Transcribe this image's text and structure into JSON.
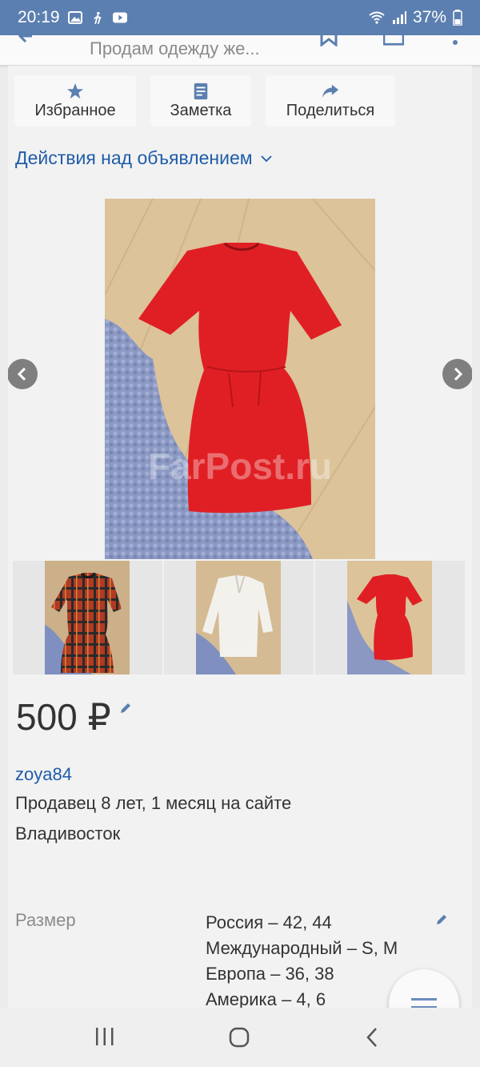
{
  "status_bar": {
    "time": "20:19",
    "battery": "37%"
  },
  "app_bar": {
    "title": "Продам одежду же..."
  },
  "actions": {
    "favorites": "Избранное",
    "note": "Заметка",
    "share": "Поделиться"
  },
  "actions_link": "Действия над объявлением",
  "watermark": "FarPost.ru",
  "price": "500 ₽",
  "seller": {
    "name": "zoya84",
    "since": "Продавец 8 лет, 1 месяц на сайте",
    "city": "Владивосток"
  },
  "size": {
    "label": "Размер",
    "values": [
      "Россия – 42, 44",
      "Международный – S, M",
      "Европа – 36, 38",
      "Америка – 4, 6"
    ]
  },
  "colors": {
    "status_bar": "#5b7fb0",
    "link": "#1f5ca8",
    "dress_red": "#e01f24"
  }
}
